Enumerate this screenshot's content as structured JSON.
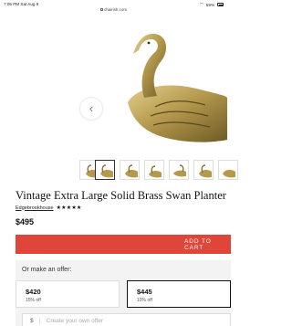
{
  "status_bar": {
    "time": "7:05 PM",
    "date": "Sat Aug 6",
    "battery": "59%"
  },
  "url_bar": {
    "domain": "chairish.com"
  },
  "gallery": {
    "prev_icon": "chevron-left-icon",
    "thumbnail_count": 6,
    "active_thumbnail": 1
  },
  "product": {
    "title": "Vintage Extra Large Solid Brass Swan Planter",
    "seller": "Edgebrookhouse",
    "stars": "★★★★★",
    "price": "$495"
  },
  "actions": {
    "add_to_cart": "ADD TO CART"
  },
  "offers": {
    "heading": "Or make an offer:",
    "options": [
      {
        "amount": "$420",
        "discount": "15% off"
      },
      {
        "amount": "$445",
        "discount": "10% off"
      }
    ],
    "custom": {
      "currency": "$",
      "placeholder": "Create your own offer"
    }
  },
  "colors": {
    "accent": "#e0453a",
    "brass": "#b59a4e"
  }
}
